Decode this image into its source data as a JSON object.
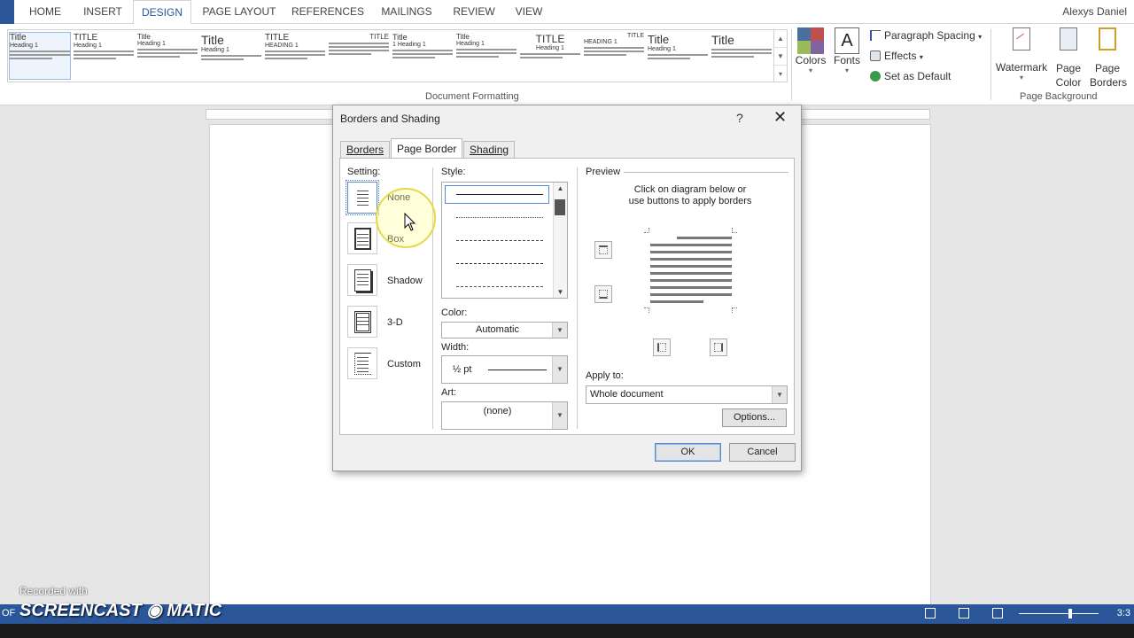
{
  "ribbon_tabs": [
    {
      "label": "HOME"
    },
    {
      "label": "INSERT"
    },
    {
      "label": "DESIGN"
    },
    {
      "label": "PAGE LAYOUT"
    },
    {
      "label": "REFERENCES"
    },
    {
      "label": "MAILINGS"
    },
    {
      "label": "REVIEW"
    },
    {
      "label": "VIEW"
    }
  ],
  "user_name": "Alexys Daniel",
  "gallery": {
    "items": [
      {
        "title": "Title",
        "sub": "Heading 1"
      },
      {
        "title": "TITLE",
        "sub": "Heading 1"
      },
      {
        "title": "Title",
        "sub": "Heading 1"
      },
      {
        "title": "Title",
        "sub": "Heading 1"
      },
      {
        "title": "TITLE",
        "sub": "HEADING 1"
      },
      {
        "title": "TITLE",
        "sub": ""
      },
      {
        "title": "Title",
        "sub": "1 Heading 1"
      },
      {
        "title": "Title",
        "sub": "Heading 1"
      },
      {
        "title": "TITLE",
        "sub": "Heading 1"
      },
      {
        "title": "TITLE",
        "sub": "HEADING 1"
      },
      {
        "title": "Title",
        "sub": "Heading 1"
      },
      {
        "title": "Title",
        "sub": ""
      }
    ]
  },
  "groups": {
    "document_formatting": "Document Formatting",
    "page_background": "Page Background"
  },
  "buttons": {
    "colors": "Colors",
    "fonts": "Fonts",
    "fonts_glyph": "A",
    "paragraph_spacing": "Paragraph Spacing",
    "effects": "Effects",
    "set_as_default": "Set as Default",
    "watermark": "Watermark",
    "page_color": "Page Color",
    "page_borders": "Page Borders"
  },
  "dialog": {
    "title": "Borders and Shading",
    "help": "?",
    "close": "✕",
    "tabs": [
      {
        "label": "Borders"
      },
      {
        "label": "Page Border"
      },
      {
        "label": "Shading"
      }
    ],
    "setting_label": "Setting:",
    "settings": [
      {
        "label": "None"
      },
      {
        "label": "Box"
      },
      {
        "label": "Shadow"
      },
      {
        "label": "3-D"
      },
      {
        "label": "Custom"
      }
    ],
    "style_label": "Style:",
    "color_label": "Color:",
    "color_value": "Automatic",
    "width_label": "Width:",
    "width_value": "½ pt",
    "art_label": "Art:",
    "art_value": "(none)",
    "preview_label": "Preview",
    "preview_note_1": "Click on diagram below or",
    "preview_note_2": "use buttons to apply borders",
    "apply_to_label": "Apply to:",
    "apply_to_value": "Whole document",
    "options_button": "Options...",
    "ok_button": "OK",
    "cancel_button": "Cancel"
  },
  "watermark": {
    "recorded_with": "Recorded with",
    "brand": "SCREENCAST ◉ MATIC"
  },
  "status": {
    "left": "OF",
    "time": "3:3"
  },
  "colors": {
    "accent": "#2b579a",
    "highlight": "#e4d84a"
  }
}
